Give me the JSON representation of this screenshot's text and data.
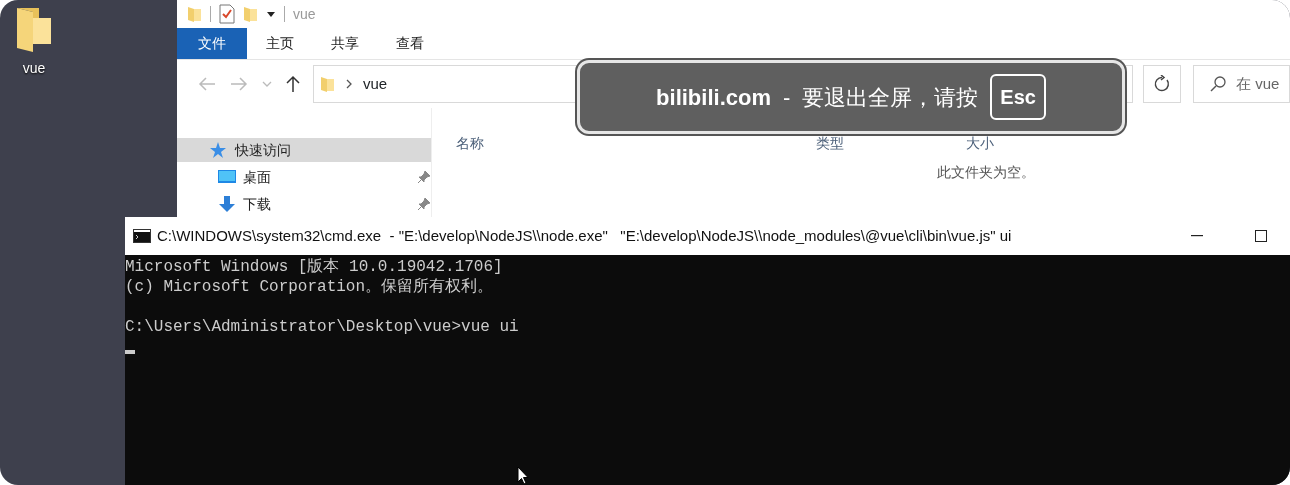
{
  "desktop": {
    "icons": [
      {
        "label": "vue"
      }
    ]
  },
  "explorer": {
    "title": "vue",
    "ribbon_tabs": [
      {
        "label": "文件",
        "selected": true
      },
      {
        "label": "主页",
        "selected": false
      },
      {
        "label": "共享",
        "selected": false
      },
      {
        "label": "查看",
        "selected": false
      }
    ],
    "address": {
      "path": "vue"
    },
    "search": {
      "placeholder": "在 vue"
    },
    "nav": [
      {
        "label": "快速访问",
        "selected": true,
        "pinned": false,
        "kind": "star"
      },
      {
        "label": "桌面",
        "selected": false,
        "pinned": true,
        "kind": "desktop"
      },
      {
        "label": "下载",
        "selected": false,
        "pinned": true,
        "kind": "download"
      }
    ],
    "columns": [
      "名称",
      "类型",
      "大小"
    ],
    "empty_message": "此文件夹为空。"
  },
  "console": {
    "title": "C:\\WINDOWS\\system32\\cmd.exe  - \"E:\\develop\\NodeJS\\\\node.exe\"   \"E:\\develop\\NodeJS\\\\node_modules\\@vue\\cli\\bin\\vue.js\" ui",
    "blocks": [
      [
        "Microsoft Windows [版本 10.0.19042.1706]",
        "(c) Microsoft Corporation。保留所有权利。"
      ],
      [
        "C:\\Users\\Administrator\\Desktop\\vue>vue ui"
      ]
    ],
    "cursor": true
  },
  "fullscreen_notice": {
    "site": "bilibili.com",
    "separator": "-",
    "message": "要退出全屏，请按",
    "key": "Esc"
  }
}
